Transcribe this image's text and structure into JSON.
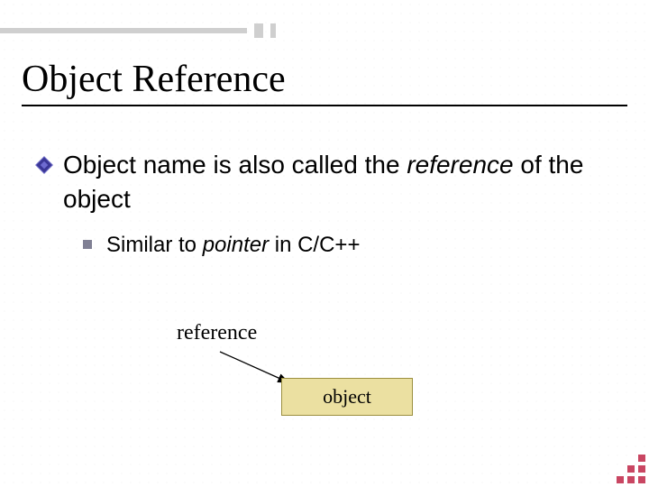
{
  "title": "Object Reference",
  "bullet1": {
    "pre": "Object name is also called the ",
    "em": "reference",
    "post": " of the object"
  },
  "sub1": {
    "pre": "Similar to ",
    "em": "pointer",
    "post": " in C/C++"
  },
  "diagram": {
    "ref_label": "reference",
    "box_label": "object"
  }
}
